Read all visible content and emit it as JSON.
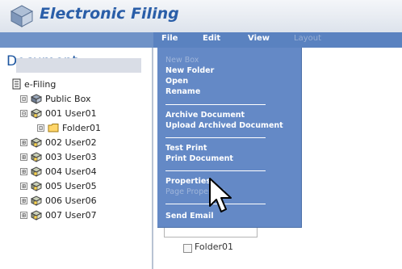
{
  "app": {
    "title": "Electronic Filing",
    "brand_color": "#2a5ea8"
  },
  "menubar": {
    "items": [
      {
        "label": "File",
        "enabled": true
      },
      {
        "label": "Edit",
        "enabled": true
      },
      {
        "label": "View",
        "enabled": true
      },
      {
        "label": "Layout",
        "enabled": false
      }
    ]
  },
  "left_panel": {
    "title": "Document",
    "tree": {
      "root": {
        "label": "e-Filing",
        "icon": "efiling-icon"
      },
      "public": {
        "label": "Public Box",
        "icon": "box-icon",
        "expander": "⊟"
      },
      "user01": {
        "label": "001 User01",
        "icon": "user-box-icon",
        "expander": "⊟",
        "selected": true
      },
      "folder01": {
        "label": "Folder01",
        "icon": "folder-icon",
        "expander": "⊟"
      },
      "users": [
        {
          "label": "002 User02",
          "icon": "user-box-icon",
          "expander": "⊞"
        },
        {
          "label": "003 User03",
          "icon": "user-box-icon",
          "expander": "⊞"
        },
        {
          "label": "004 User04",
          "icon": "user-box-icon",
          "expander": "⊞"
        },
        {
          "label": "005 User05",
          "icon": "user-box-icon",
          "expander": "⊞"
        },
        {
          "label": "006 User06",
          "icon": "user-box-icon",
          "expander": "⊞"
        },
        {
          "label": "007 User07",
          "icon": "user-box-icon",
          "expander": "⊞"
        }
      ]
    }
  },
  "file_menu": {
    "items": [
      {
        "label": "New Box",
        "enabled": false
      },
      {
        "label": "New Folder",
        "enabled": true
      },
      {
        "label": "Open",
        "enabled": true
      },
      {
        "label": "Rename",
        "enabled": true
      },
      {
        "label": "Archive Document",
        "enabled": true
      },
      {
        "label": "Upload Archived Document",
        "enabled": true
      },
      {
        "label": "Test Print",
        "enabled": true
      },
      {
        "label": "Print Document",
        "enabled": true
      },
      {
        "label": "Properties",
        "enabled": true
      },
      {
        "label": "Page Properties",
        "enabled": false
      },
      {
        "label": "Send Email",
        "enabled": true
      }
    ],
    "background_color": "#6489c6"
  },
  "content": {
    "folder_item": {
      "label": "Folder01",
      "checked": false
    }
  },
  "cursor": {
    "icon": "pointer-cursor-icon"
  }
}
